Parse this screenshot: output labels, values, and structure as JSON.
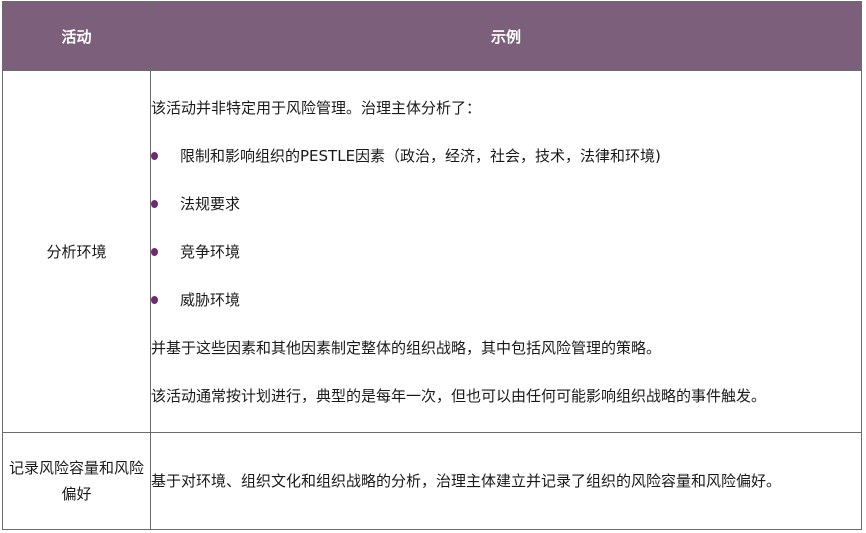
{
  "table": {
    "headers": {
      "activity": "活动",
      "example": "示例"
    },
    "rows": [
      {
        "activity": "分析环境",
        "intro": "该活动并非特定用于风险管理。治理主体分析了：",
        "bullets": [
          "限制和影响组织的PESTLE因素（政治，经济，社会，技术，法律和环境)",
          "法规要求",
          "竞争环境",
          "威胁环境"
        ],
        "after": "并基于这些因素和其他因素制定整体的组织战略，其中包括风险管理的策略。",
        "note": "该活动通常按计划进行，典型的是每年一次，但也可以由任何可能影响组织战略的事件触发。"
      },
      {
        "activity": "记录风险容量和风险偏好",
        "example": "基于对环境、组织文化和组织战略的分析，治理主体建立并记录了组织的风险容量和风险偏好。"
      }
    ]
  },
  "colors": {
    "header_bg": "#7b5f7b",
    "header_text": "#ffffff",
    "bullet": "#6e2b6e",
    "border": "#6b6b6b"
  }
}
